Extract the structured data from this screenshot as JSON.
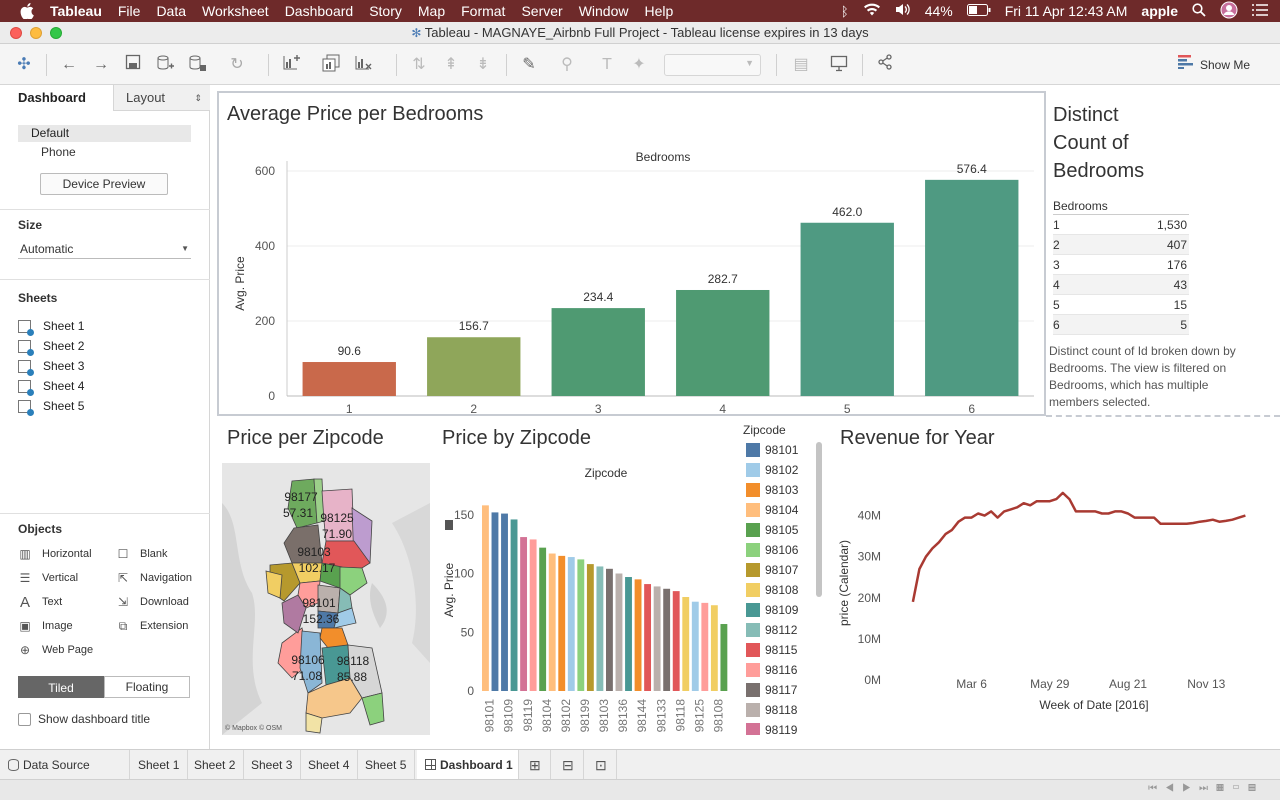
{
  "menubar": {
    "app": "Tableau",
    "items": [
      "File",
      "Data",
      "Worksheet",
      "Dashboard",
      "Story",
      "Map",
      "Format",
      "Server",
      "Window",
      "Help"
    ],
    "battery": "44%",
    "clock": "Fri 11 Apr  12:43 AM",
    "user": "apple"
  },
  "window": {
    "title": "Tableau - MAGNAYE_Airbnb Full Project - Tableau license expires in 13 days"
  },
  "toolbar": {
    "show_me": "Show Me"
  },
  "leftpanel": {
    "tabs": [
      "Dashboard",
      "Layout"
    ],
    "devices": [
      "Default",
      "Phone"
    ],
    "device_preview": "Device Preview",
    "size_title": "Size",
    "size_value": "Automatic",
    "sheets_title": "Sheets",
    "sheets": [
      "Sheet 1",
      "Sheet 2",
      "Sheet 3",
      "Sheet 4",
      "Sheet 5"
    ],
    "objects_title": "Objects",
    "objects": [
      {
        "label": "Horizontal",
        "icon": "horizontal-icon"
      },
      {
        "label": "Blank",
        "icon": "blank-icon"
      },
      {
        "label": "Vertical",
        "icon": "vertical-icon"
      },
      {
        "label": "Navigation",
        "icon": "navigation-icon"
      },
      {
        "label": "Text",
        "icon": "text-icon"
      },
      {
        "label": "Download",
        "icon": "download-icon"
      },
      {
        "label": "Image",
        "icon": "image-icon"
      },
      {
        "label": "Extension",
        "icon": "extension-icon"
      },
      {
        "label": "Web Page",
        "icon": "web-page-icon"
      }
    ],
    "tiled": "Tiled",
    "floating": "Floating",
    "show_title": "Show dashboard title"
  },
  "dashboard": {
    "bedrooms_price": {
      "title": "Average Price per Bedrooms"
    },
    "distinct": {
      "title": [
        "Distinct",
        "Count of",
        "Bedrooms"
      ],
      "header": "Bedrooms",
      "rows": [
        [
          "1",
          "1,530"
        ],
        [
          "2",
          "407"
        ],
        [
          "3",
          "176"
        ],
        [
          "4",
          "43"
        ],
        [
          "5",
          "15"
        ],
        [
          "6",
          "5"
        ]
      ],
      "note": "Distinct count of Id broken down by Bedrooms. The view is filtered on Bedrooms, which has multiple members selected."
    },
    "zip_map": {
      "title": "Price per Zipcode",
      "labels": [
        {
          "zip": "98177",
          "price": "57.31"
        },
        {
          "zip": "98125",
          "price": "71.90"
        },
        {
          "zip": "98103",
          "price": "102.17"
        },
        {
          "zip": "98101",
          "price": "152.36"
        },
        {
          "zip": "98106",
          "price": "71.08"
        },
        {
          "zip": "98118",
          "price": "85.88"
        }
      ],
      "credit": "© Mapbox © OSM"
    },
    "zip_bar": {
      "title": "Price by Zipcode",
      "legend_title": "Zipcode",
      "legend": [
        {
          "zip": "98101",
          "color": "#4e79a7"
        },
        {
          "zip": "98102",
          "color": "#a0cbe8"
        },
        {
          "zip": "98103",
          "color": "#f28e2b"
        },
        {
          "zip": "98104",
          "color": "#ffbe7d"
        },
        {
          "zip": "98105",
          "color": "#59a14f"
        },
        {
          "zip": "98106",
          "color": "#8cd17d"
        },
        {
          "zip": "98107",
          "color": "#b6992d"
        },
        {
          "zip": "98108",
          "color": "#f1ce63"
        },
        {
          "zip": "98109",
          "color": "#499894"
        },
        {
          "zip": "98112",
          "color": "#86bcb6"
        },
        {
          "zip": "98115",
          "color": "#e15759"
        },
        {
          "zip": "98116",
          "color": "#ff9d9a"
        },
        {
          "zip": "98117",
          "color": "#79706e"
        },
        {
          "zip": "98118",
          "color": "#bab0ac"
        },
        {
          "zip": "98119",
          "color": "#d37295"
        }
      ]
    },
    "revenue": {
      "title": "Revenue for Year"
    }
  },
  "bottom_tabs": {
    "data_source": "Data Source",
    "sheets": [
      "Sheet 1",
      "Sheet 2",
      "Sheet 3",
      "Sheet 4",
      "Sheet 5"
    ],
    "dashboard": "Dashboard 1"
  },
  "chart_data": [
    {
      "type": "bar",
      "title": "Average Price per Bedrooms",
      "xlabel": "Bedrooms",
      "ylabel": "Avg. Price",
      "categories": [
        "1",
        "2",
        "3",
        "4",
        "5",
        "6"
      ],
      "values": [
        90.6,
        156.7,
        234.4,
        282.7,
        462.0,
        576.4
      ],
      "value_labels": [
        "90.6",
        "156.7",
        "234.4",
        "282.7",
        "462.0",
        "576.4"
      ],
      "colors": [
        "#c9694b",
        "#8fa65a",
        "#4f9a72",
        "#4f9a72",
        "#4f9a82",
        "#4f9a82"
      ],
      "ylim": [
        0,
        600
      ],
      "yticks": [
        0,
        200,
        400,
        600
      ],
      "grid": true
    },
    {
      "type": "bar",
      "title": "Price by Zipcode",
      "xlabel": "Zipcode",
      "ylabel": "Avg. Price",
      "categories": [
        "98101",
        "",
        "98109",
        "",
        "98119",
        "",
        "98104",
        "",
        "98102",
        "",
        "98199",
        "",
        "98103",
        "",
        "98136",
        "",
        "98144",
        "",
        "98133",
        "",
        "98118",
        "",
        "98125",
        "",
        "98108",
        ""
      ],
      "values": [
        158,
        152,
        151,
        146,
        131,
        129,
        122,
        117,
        115,
        114,
        112,
        108,
        106,
        104,
        100,
        97,
        95,
        91,
        89,
        87,
        85,
        80,
        76,
        75,
        73,
        57
      ],
      "colors": [
        "#ffbe7d",
        "#4e79a7",
        "#4e79a7",
        "#499894",
        "#d37295",
        "#ff9d9a",
        "#59a14f",
        "#ffbe7d",
        "#f28e2b",
        "#a0cbe8",
        "#8cd17d",
        "#b6992d",
        "#86bcb6",
        "#79706e",
        "#bab0ac",
        "#499894",
        "#f28e2b",
        "#e15759",
        "#bab0ac",
        "#79706e",
        "#e15759",
        "#f1ce63",
        "#a0cbe8",
        "#ff9d9a",
        "#f1ce63",
        "#59a14f"
      ],
      "ylim": [
        0,
        160
      ],
      "yticks": [
        0,
        50,
        100,
        150
      ]
    },
    {
      "type": "line",
      "title": "Revenue for Year",
      "xlabel": "Week of Date [2016]",
      "ylabel": "price (Calendar)",
      "x_ticks": [
        "Mar 6",
        "May 29",
        "Aug 21",
        "Nov 13"
      ],
      "y_ticks": [
        "0M",
        "10M",
        "20M",
        "30M",
        "40M"
      ],
      "ylim": [
        0,
        45000000
      ],
      "color": "#a93a32",
      "x": [
        "2016-01-03",
        "2016-01-10",
        "2016-01-17",
        "2016-01-24",
        "2016-01-31",
        "2016-02-07",
        "2016-02-14",
        "2016-02-21",
        "2016-02-28",
        "2016-03-06",
        "2016-03-13",
        "2016-03-20",
        "2016-03-27",
        "2016-04-03",
        "2016-04-10",
        "2016-04-17",
        "2016-04-24",
        "2016-05-01",
        "2016-05-08",
        "2016-05-15",
        "2016-05-22",
        "2016-05-29",
        "2016-06-05",
        "2016-06-12",
        "2016-06-19",
        "2016-06-26",
        "2016-07-03",
        "2016-07-10",
        "2016-07-17",
        "2016-07-24",
        "2016-07-31",
        "2016-08-07",
        "2016-08-14",
        "2016-08-21",
        "2016-08-28",
        "2016-09-04",
        "2016-09-11",
        "2016-09-18",
        "2016-09-25",
        "2016-10-02",
        "2016-10-09",
        "2016-10-16",
        "2016-10-23",
        "2016-10-30",
        "2016-11-06",
        "2016-11-13",
        "2016-11-20",
        "2016-11-27",
        "2016-12-04",
        "2016-12-11",
        "2016-12-18",
        "2016-12-25"
      ],
      "values": [
        19000000,
        27000000,
        30000000,
        32000000,
        33500000,
        35500000,
        36500000,
        38500000,
        39500000,
        39500000,
        40500000,
        40000000,
        41000000,
        39500000,
        41000000,
        41500000,
        42000000,
        43000000,
        42500000,
        43500000,
        43500000,
        43500000,
        44000000,
        45500000,
        44000000,
        41000000,
        41000000,
        41000000,
        41000000,
        40500000,
        40500000,
        41000000,
        41000000,
        40500000,
        39500000,
        39500000,
        39500000,
        39500000,
        38000000,
        38000000,
        38000000,
        38000000,
        38000000,
        38200000,
        38500000,
        38700000,
        39000000,
        38500000,
        38700000,
        39000000,
        39500000,
        40000000
      ]
    }
  ]
}
